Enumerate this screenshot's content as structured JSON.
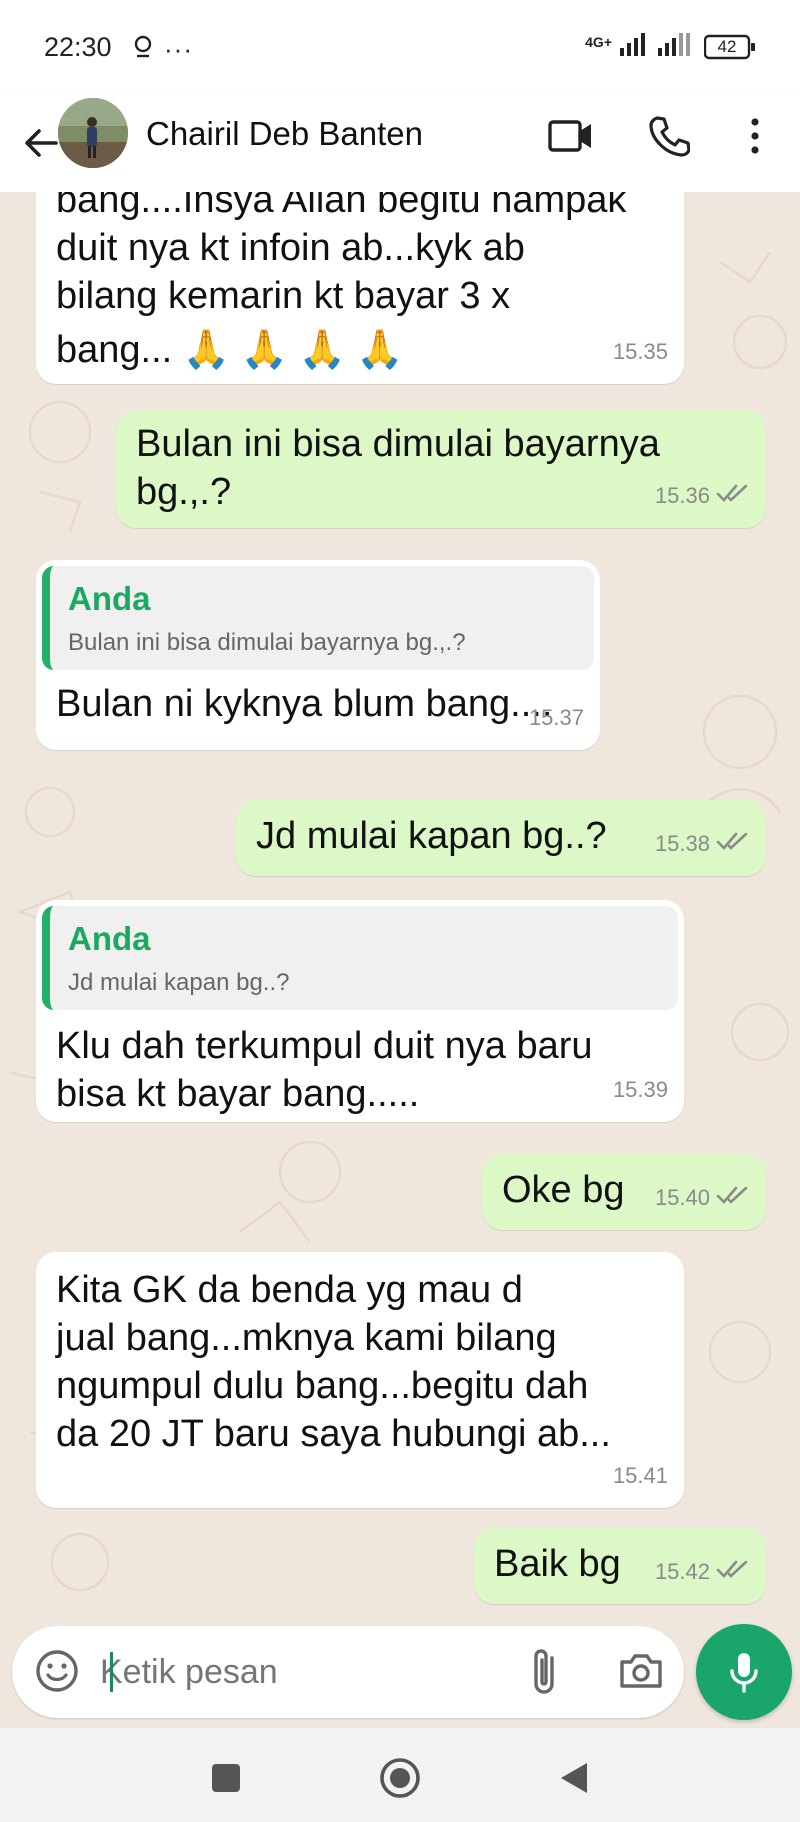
{
  "status_bar": {
    "time": "22:30",
    "more": "···",
    "network": "4G+",
    "battery": "42"
  },
  "app_bar": {
    "contact_name": "Chairil Deb Banten"
  },
  "messages": [
    {
      "direction": "in",
      "lines": [
        "bang....Insya Allah begitu nampak",
        "duit nya kt infoin ab...kyk ab",
        "bilang kemarin kt bayar 3 x",
        "bang... 🙏 🙏 🙏 🙏"
      ],
      "time": "15.35"
    },
    {
      "direction": "out",
      "lines": [
        "Bulan ini bisa dimulai bayarnya",
        "bg.,.?"
      ],
      "time": "15.36"
    },
    {
      "direction": "in",
      "quote": {
        "author": "Anda",
        "text": "Bulan ini bisa dimulai bayarnya bg.,.?"
      },
      "lines": [
        "Bulan ni kyknya blum bang...."
      ],
      "time": "15.37"
    },
    {
      "direction": "out",
      "lines": [
        "Jd mulai kapan bg..?"
      ],
      "time": "15.38"
    },
    {
      "direction": "in",
      "quote": {
        "author": "Anda",
        "text": "Jd mulai kapan bg..?"
      },
      "lines": [
        "Klu dah terkumpul duit nya baru",
        "bisa kt bayar bang....."
      ],
      "time": "15.39"
    },
    {
      "direction": "out",
      "lines": [
        "Oke bg"
      ],
      "time": "15.40"
    },
    {
      "direction": "in",
      "lines": [
        "Kita GK da benda yg mau d",
        "jual bang...mknya kami bilang",
        "ngumpul dulu bang...begitu dah",
        "da 20 JT baru saya hubungi ab..."
      ],
      "time": "15.41"
    },
    {
      "direction": "out",
      "lines": [
        "Baik bg"
      ],
      "time": "15.42"
    }
  ],
  "composer": {
    "placeholder": "Ketik pesan"
  },
  "colors": {
    "accent": "#1aa56c",
    "outgoing_bubble": "#dcf8c6",
    "incoming_bubble": "#ffffff",
    "chat_background": "#efe7dd",
    "read_ticks": "#8a8a8a"
  }
}
